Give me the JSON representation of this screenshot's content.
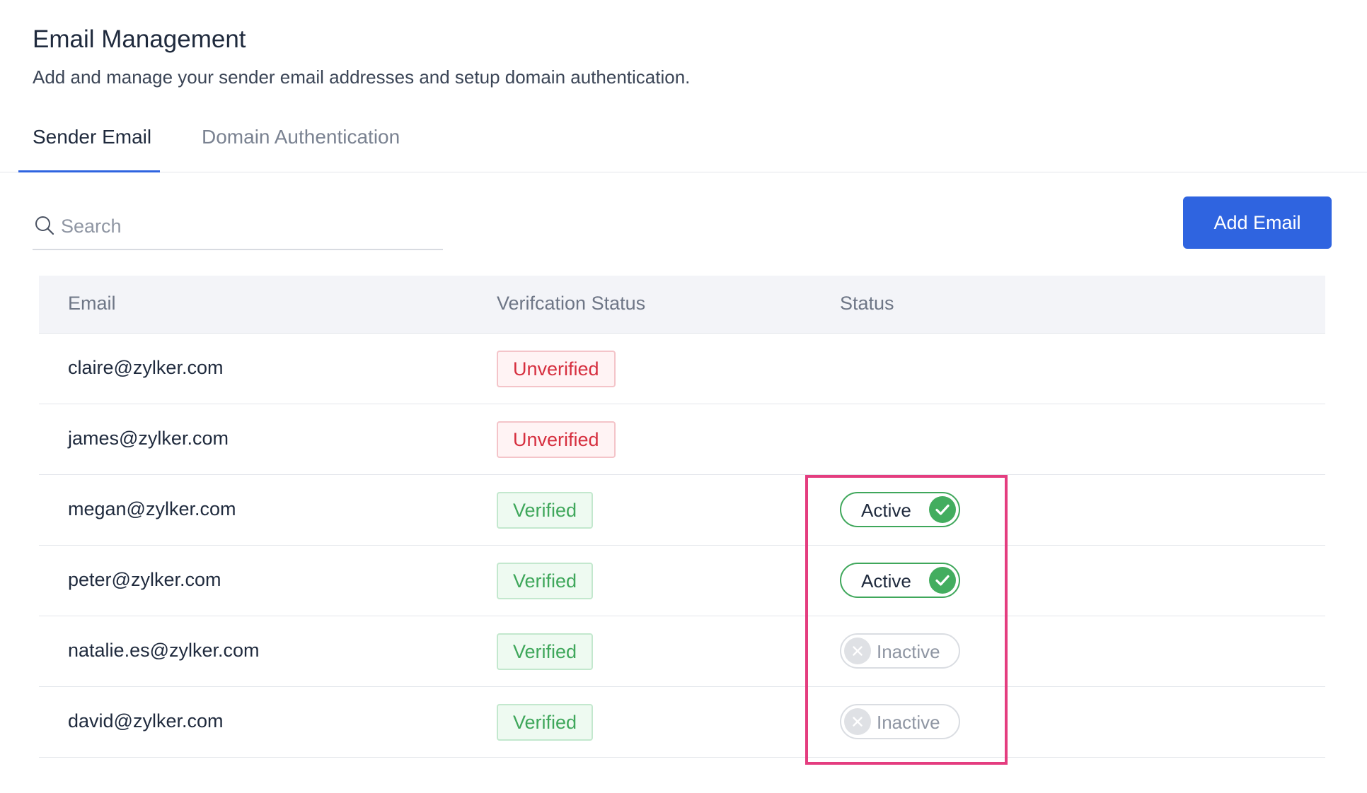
{
  "header": {
    "title": "Email Management",
    "subtitle": "Add and manage your sender email addresses and setup domain authentication."
  },
  "tabs": [
    {
      "label": "Sender Email",
      "active": true
    },
    {
      "label": "Domain Authentication",
      "active": false
    }
  ],
  "search": {
    "placeholder": "Search",
    "value": ""
  },
  "toolbar": {
    "add_label": "Add Email"
  },
  "table": {
    "columns": [
      "Email",
      "Verifcation Status",
      "Status"
    ],
    "rows": [
      {
        "email": "claire@zylker.com",
        "verification": "Unverified",
        "status": ""
      },
      {
        "email": "james@zylker.com",
        "verification": "Unverified",
        "status": ""
      },
      {
        "email": "megan@zylker.com",
        "verification": "Verified",
        "status": "Active"
      },
      {
        "email": "peter@zylker.com",
        "verification": "Verified",
        "status": "Active"
      },
      {
        "email": "natalie.es@zylker.com",
        "verification": "Verified",
        "status": "Inactive"
      },
      {
        "email": "david@zylker.com",
        "verification": "Verified",
        "status": "Inactive"
      }
    ]
  },
  "colors": {
    "accent": "#2f64e0",
    "verified": "#3fa75b",
    "unverified": "#d62f3f",
    "highlight": "#e43d7f"
  },
  "icons": {
    "search": "search-icon",
    "active": "check-circle-icon",
    "inactive": "x-circle-icon"
  }
}
